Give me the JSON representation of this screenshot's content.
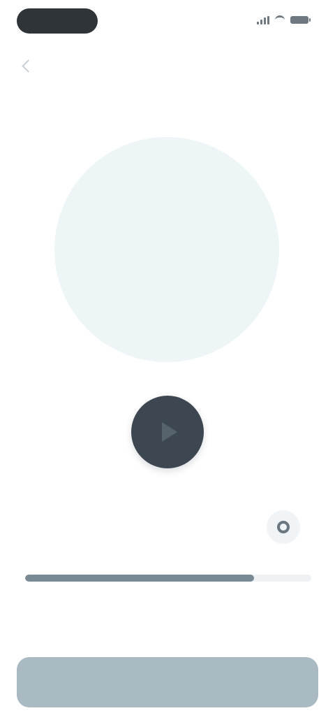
{
  "status_bar": {
    "icons": [
      "signal-icon",
      "wifi-icon",
      "battery-icon"
    ]
  },
  "header": {
    "back_icon": "chevron-left-icon",
    "title": ""
  },
  "timer": {
    "readout": ""
  },
  "main_action": {
    "icon": "play-icon"
  },
  "settings": {
    "label": "",
    "icon": "gear-icon"
  },
  "progress": {
    "fraction": 0.8,
    "left_label": "",
    "right_label": ""
  },
  "primary_button": {
    "label": ""
  },
  "colors": {
    "accent": "#3c4751",
    "circle": "#eef5f7",
    "button": "#a9bac3",
    "progress_fill": "#7a8a95"
  }
}
